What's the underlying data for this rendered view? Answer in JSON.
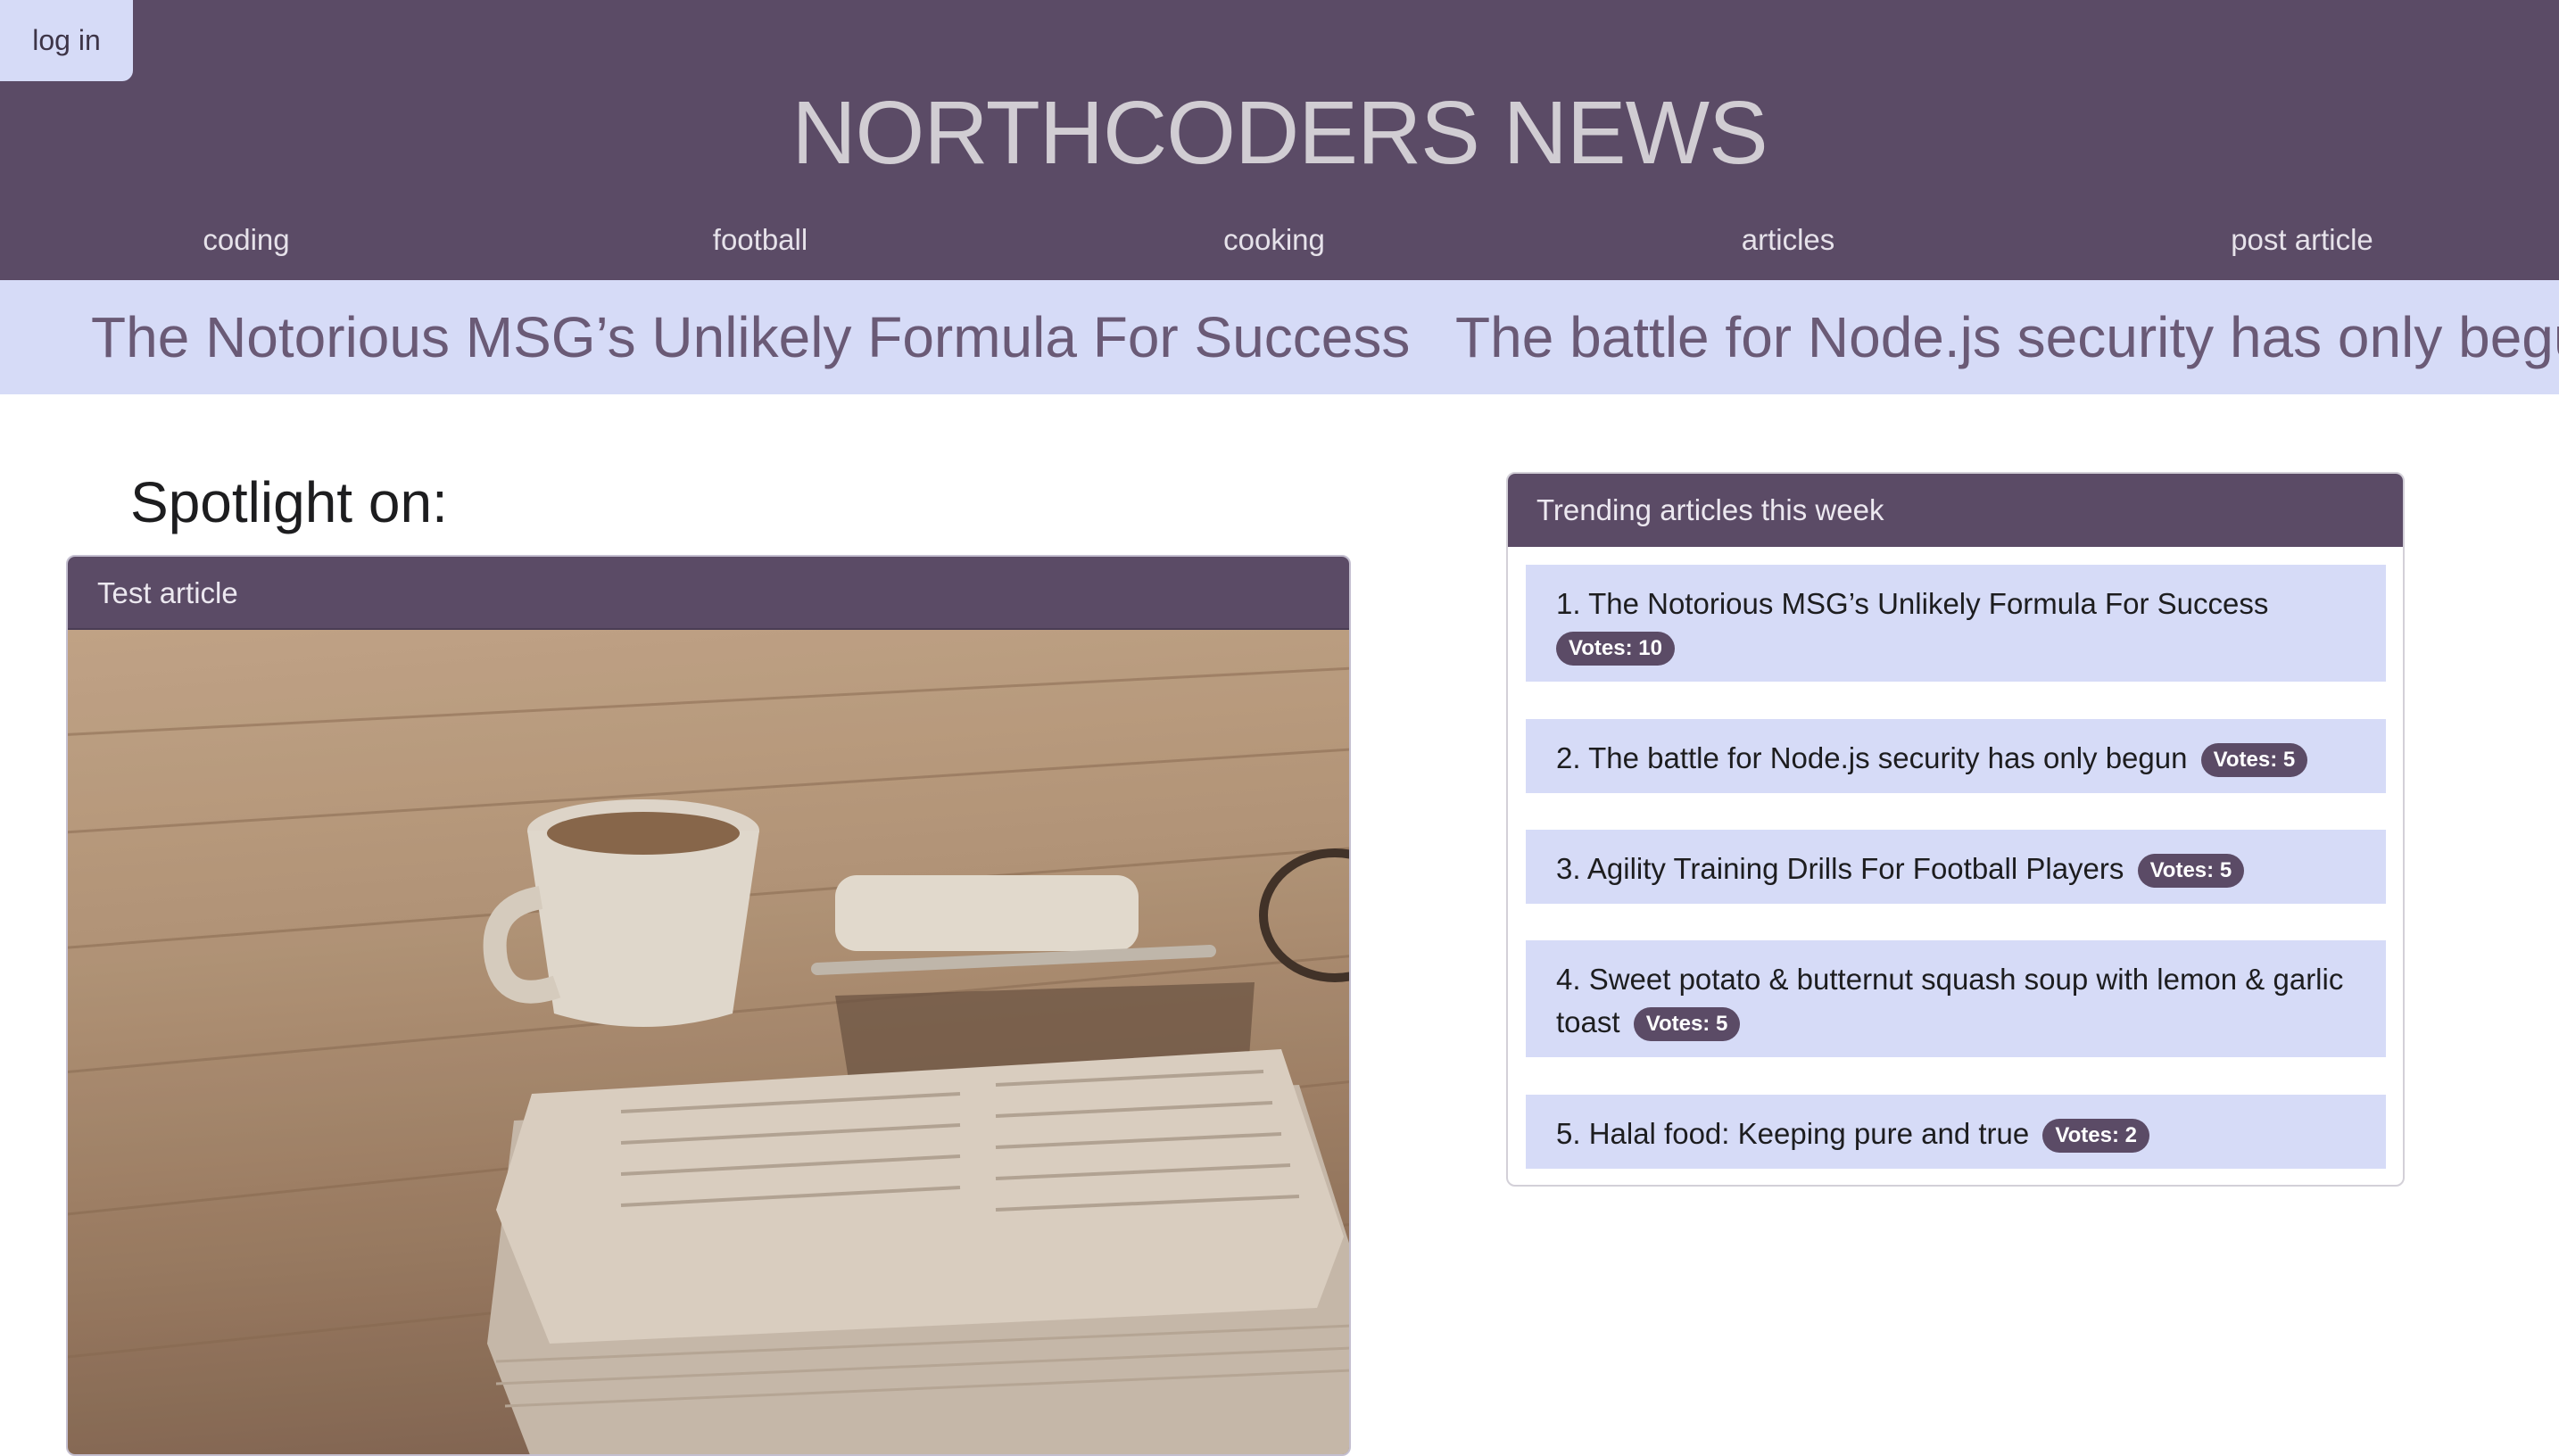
{
  "header": {
    "login_label": "log in",
    "site_title": "NORTHCODERS NEWS",
    "nav": [
      {
        "label": "coding"
      },
      {
        "label": "football"
      },
      {
        "label": "cooking"
      },
      {
        "label": "articles"
      },
      {
        "label": "post article"
      }
    ],
    "background_color": "#5b4b66"
  },
  "ticker": {
    "items": [
      {
        "title": "The Notorious MSG’s Unlikely Formula For Success"
      },
      {
        "title": "The battle for Node.js security has only begun"
      }
    ],
    "background_color": "#d6dbf7"
  },
  "spotlight": {
    "heading": "Spotlight on:",
    "article_title": "Test article",
    "image_icon": "newspaper-coffee-photo"
  },
  "trending": {
    "heading": "Trending articles this week",
    "items": [
      {
        "title": "1. The Notorious MSG’s Unlikely Formula For Success",
        "votes": "Votes: 10"
      },
      {
        "title": "2. The battle for Node.js security has only begun",
        "votes": "Votes: 5"
      },
      {
        "title": "3. Agility Training Drills For Football Players",
        "votes": "Votes: 5"
      },
      {
        "title": "4. Sweet potato & butternut squash soup with lemon & garlic toast",
        "votes": "Votes: 5"
      },
      {
        "title": "5. Halal food: Keeping pure and true",
        "votes": "Votes: 2"
      }
    ]
  }
}
